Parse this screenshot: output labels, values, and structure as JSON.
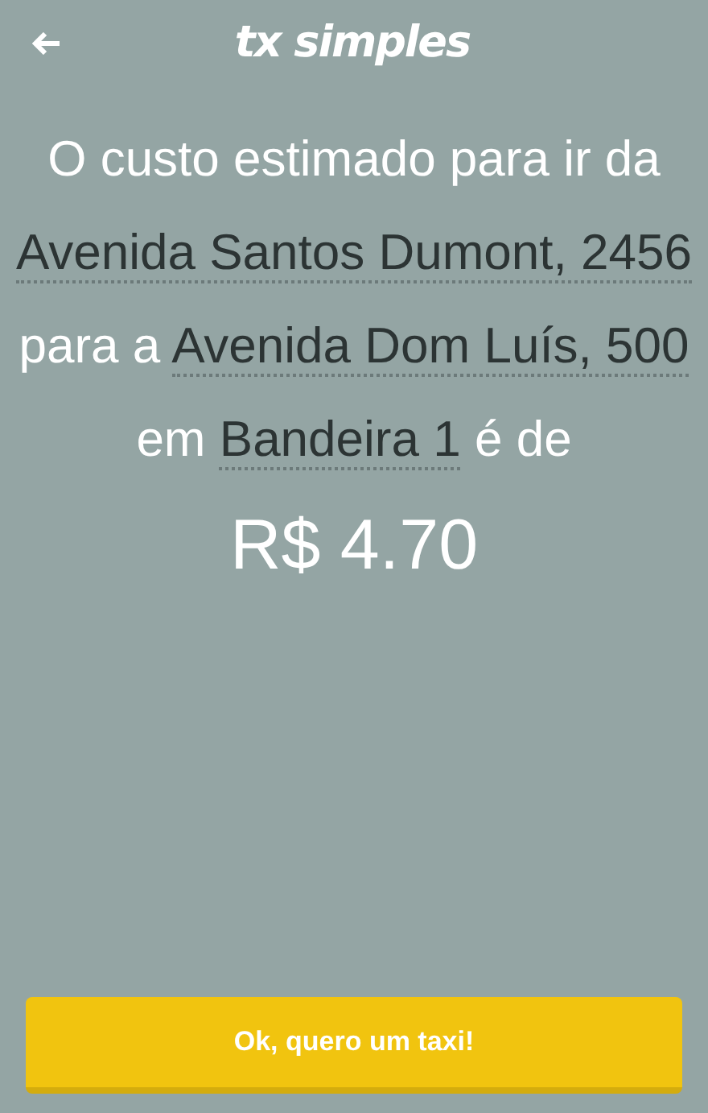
{
  "header": {
    "title": "tx simples"
  },
  "estimate": {
    "parts": [
      {
        "kind": "text",
        "text": "O custo estimado para ir da"
      },
      {
        "kind": "link",
        "text": "Avenida Santos Dumont, 2456"
      },
      {
        "kind": "text",
        "text": "para a"
      },
      {
        "kind": "link",
        "text": "Avenida Dom Luís, 500"
      },
      {
        "kind": "text",
        "text": "em"
      },
      {
        "kind": "link",
        "text": "Bandeira 1"
      },
      {
        "kind": "text",
        "text": "é de"
      }
    ],
    "price": "R$ 4.70"
  },
  "buttons": [
    "Ok, quero um taxi!"
  ]
}
